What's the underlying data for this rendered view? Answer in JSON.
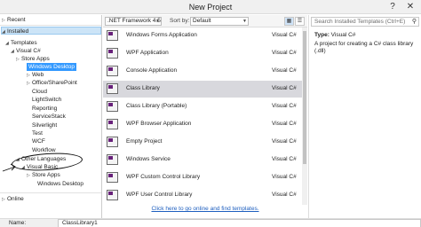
{
  "window": {
    "title": "New Project",
    "help": "?",
    "close": "✕"
  },
  "left": {
    "recent": "Recent",
    "installed": "Installed",
    "templates": "Templates",
    "tree": [
      {
        "label": "Visual C#",
        "arrow": "◢"
      },
      {
        "label": "Store Apps",
        "arrow": "▷"
      },
      {
        "label": "Windows Desktop",
        "arrow": ""
      },
      {
        "label": "Web",
        "arrow": "▷"
      },
      {
        "label": "Office/SharePoint",
        "arrow": "▷"
      },
      {
        "label": "Cloud",
        "arrow": ""
      },
      {
        "label": "LightSwitch",
        "arrow": ""
      },
      {
        "label": "Reporting",
        "arrow": ""
      },
      {
        "label": "ServiceStack",
        "arrow": ""
      },
      {
        "label": "Silverlight",
        "arrow": ""
      },
      {
        "label": "Test",
        "arrow": ""
      },
      {
        "label": "WCF",
        "arrow": ""
      },
      {
        "label": "Workflow",
        "arrow": ""
      },
      {
        "label": "Other Languages",
        "arrow": "◢"
      },
      {
        "label": "Visual Basic",
        "arrow": "◢"
      },
      {
        "label": "Store Apps",
        "arrow": "▷"
      },
      {
        "label": "Windows Desktop",
        "arrow": ""
      }
    ],
    "online": "Online"
  },
  "toolbar": {
    "framework": ".NET Framework 4.5",
    "sort_label": "Sort by:",
    "sort_value": "Default"
  },
  "templates": [
    {
      "name": "Windows Forms Application",
      "lang": "Visual C#"
    },
    {
      "name": "WPF Application",
      "lang": "Visual C#"
    },
    {
      "name": "Console Application",
      "lang": "Visual C#"
    },
    {
      "name": "Class Library",
      "lang": "Visual C#"
    },
    {
      "name": "Class Library (Portable)",
      "lang": "Visual C#"
    },
    {
      "name": "WPF Browser Application",
      "lang": "Visual C#"
    },
    {
      "name": "Empty Project",
      "lang": "Visual C#"
    },
    {
      "name": "Windows Service",
      "lang": "Visual C#"
    },
    {
      "name": "WPF Custom Control Library",
      "lang": "Visual C#"
    },
    {
      "name": "WPF User Control Library",
      "lang": "Visual C#"
    }
  ],
  "online_link": "Click here to go online and find templates.",
  "right": {
    "search_placeholder": "Search Installed Templates (Ctrl+E)",
    "type_label": "Type:",
    "type_value": "Visual C#",
    "description": "A project for creating a C# class library (.dll)"
  },
  "bottom": {
    "name_label": "Name:",
    "name_value": "ClassLibrary1"
  }
}
